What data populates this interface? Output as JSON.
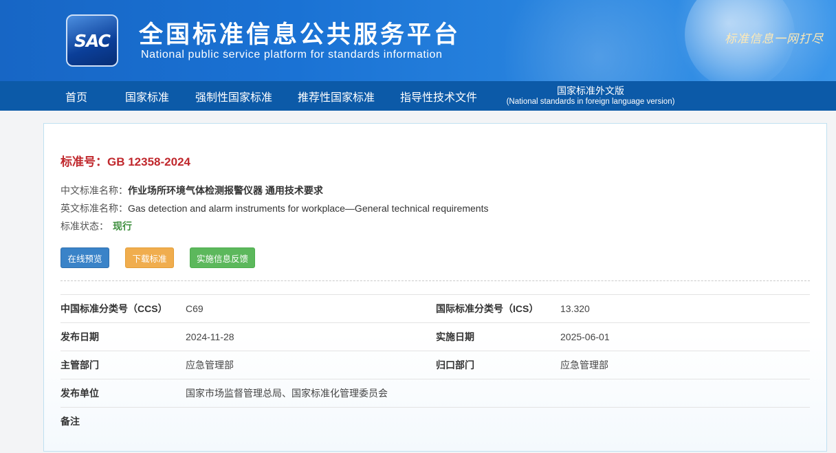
{
  "header": {
    "logo_text": "SAC",
    "title": "全国标准信息公共服务平台",
    "subtitle": "National public service platform  for standards information",
    "slogan": "标准信息一网打尽",
    "brand_color": "#1a72d4"
  },
  "nav": {
    "items": [
      {
        "label": "首页"
      },
      {
        "label": "国家标准"
      },
      {
        "label": "强制性国家标准"
      },
      {
        "label": "推荐性国家标准"
      },
      {
        "label": "指导性技术文件"
      }
    ],
    "foreign": {
      "label": "国家标准外文版",
      "sub": "(National standards in foreign language version)"
    },
    "bg_color": "#0c5aa8"
  },
  "standard": {
    "number_label": "标准号：GB 12358-2024",
    "cn_name_label": "中文标准名称：",
    "cn_name": "作业场所环境气体检测报警仪器 通用技术要求",
    "en_name_label": "英文标准名称：",
    "en_name": "Gas detection and alarm instruments for workplace—General technical requirements",
    "status_label": "标准状态：",
    "status": "现行"
  },
  "buttons": {
    "preview": "在线预览",
    "download": "下载标准",
    "feedback": "实施信息反馈"
  },
  "details": {
    "ccs_label": "中国标准分类号（CCS）",
    "ccs": "C69",
    "ics_label": "国际标准分类号（ICS）",
    "ics": "13.320",
    "publish_date_label": "发布日期",
    "publish_date": "2024-11-28",
    "implement_date_label": "实施日期",
    "implement_date": "2025-06-01",
    "competent_dept_label": "主管部门",
    "competent_dept": "应急管理部",
    "centralized_dept_label": "归口部门",
    "centralized_dept": "应急管理部",
    "publisher_label": "发布单位",
    "publisher": "国家市场监督管理总局、国家标准化管理委员会",
    "remarks_label": "备注",
    "remarks": ""
  }
}
